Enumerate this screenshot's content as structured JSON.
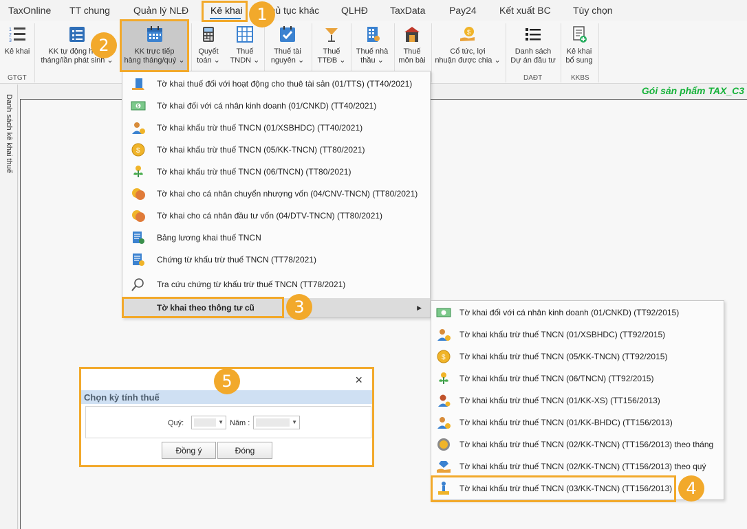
{
  "menubar": {
    "items": [
      "TaxOnline",
      "TT chung",
      "Quản lý NLĐ",
      "Kê khai",
      "Thủ tục khác",
      "QLHĐ",
      "TaxData",
      "Pay24",
      "Kết xuất BC",
      "Tùy chọn"
    ],
    "active": "Kê khai"
  },
  "ribbon": {
    "buttons": [
      {
        "l1": "Kê khai",
        "l2": ""
      },
      {
        "l1": "KK tự động hàng",
        "l2": "tháng/lần phát sinh ⌄"
      },
      {
        "l1": "KK trực tiếp",
        "l2": "hàng tháng/quý ⌄"
      },
      {
        "l1": "Quyết",
        "l2": "toán ⌄"
      },
      {
        "l1": "Thuế",
        "l2": "TNDN ⌄"
      },
      {
        "l1": "Thuế tài",
        "l2": "nguyên ⌄"
      },
      {
        "l1": "Thuế",
        "l2": "TTĐB ⌄"
      },
      {
        "l1": "Thuế nhà",
        "l2": "thầu ⌄"
      },
      {
        "l1": "Thuế",
        "l2": "môn bài"
      },
      {
        "l1": "Cổ tức, lợi",
        "l2": "nhuận được chia ⌄"
      },
      {
        "l1": "Danh sách",
        "l2": "Dự án đầu tư"
      },
      {
        "l1": "Kê khai",
        "l2": "bổ sung"
      }
    ],
    "groups": [
      "GTGT",
      "DAĐT",
      "KKBS"
    ]
  },
  "product_label": "Gói sản phẩm TAX_C3",
  "side_panel_label": "Danh sách kê khai thuế",
  "dropdown": {
    "items": [
      "Tờ khai thuế đối với hoạt động cho thuê tài sản (01/TTS) (TT40/2021)",
      "Tờ khai đối với cá nhân kinh doanh (01/CNKD) (TT40/2021)",
      "Tờ khai khấu trừ thuế TNCN (01/XSBHDC) (TT40/2021)",
      "Tờ khai khấu trừ thuế TNCN (05/KK-TNCN) (TT80/2021)",
      "Tờ khai khấu trừ thuế TNCN (06/TNCN) (TT80/2021)",
      "Tờ khai cho cá nhân chuyển nhượng vốn (04/CNV-TNCN) (TT80/2021)",
      "Tờ khai cho cá nhân đầu tư vốn (04/DTV-TNCN) (TT80/2021)",
      "Bảng lương khai thuế TNCN",
      "Chứng từ khấu trừ thuế TNCN (TT78/2021)",
      "Tra cứu chứng từ khấu trừ thuế TNCN (TT78/2021)",
      "Tờ khai theo thông tư cũ"
    ]
  },
  "submenu": {
    "items": [
      "Tờ khai đối với cá nhân kinh doanh (01/CNKD) (TT92/2015)",
      "Tờ khai khấu trừ thuế TNCN (01/XSBHDC) (TT92/2015)",
      "Tờ khai khấu trừ thuế TNCN (05/KK-TNCN) (TT92/2015)",
      "Tờ khai khấu trừ thuế TNCN (06/TNCN) (TT92/2015)",
      "Tờ khai khấu trừ thuế TNCN (01/KK-XS) (TT156/2013)",
      "Tờ khai khấu trừ thuế TNCN (01/KK-BHDC) (TT156/2013)",
      "Tờ khai khấu trừ thuế TNCN (02/KK-TNCN) (TT156/2013) theo tháng",
      "Tờ khai khấu trừ thuế TNCN (02/KK-TNCN) (TT156/2013) theo quý",
      "Tờ khai khấu trừ thuế TNCN (03/KK-TNCN) (TT156/2013)"
    ]
  },
  "dialog": {
    "title": "Chọn kỳ tính thuế",
    "quarter_label": "Quý:",
    "year_label": "Năm :",
    "ok_label": "Đồng ý",
    "close_label": "Đóng",
    "close_icon": "×"
  },
  "badges": [
    "1",
    "2",
    "3",
    "4",
    "5"
  ],
  "colors": {
    "highlight": "#f2a92b",
    "product": "#17b23a",
    "tab_underline": "#2b79c2"
  }
}
